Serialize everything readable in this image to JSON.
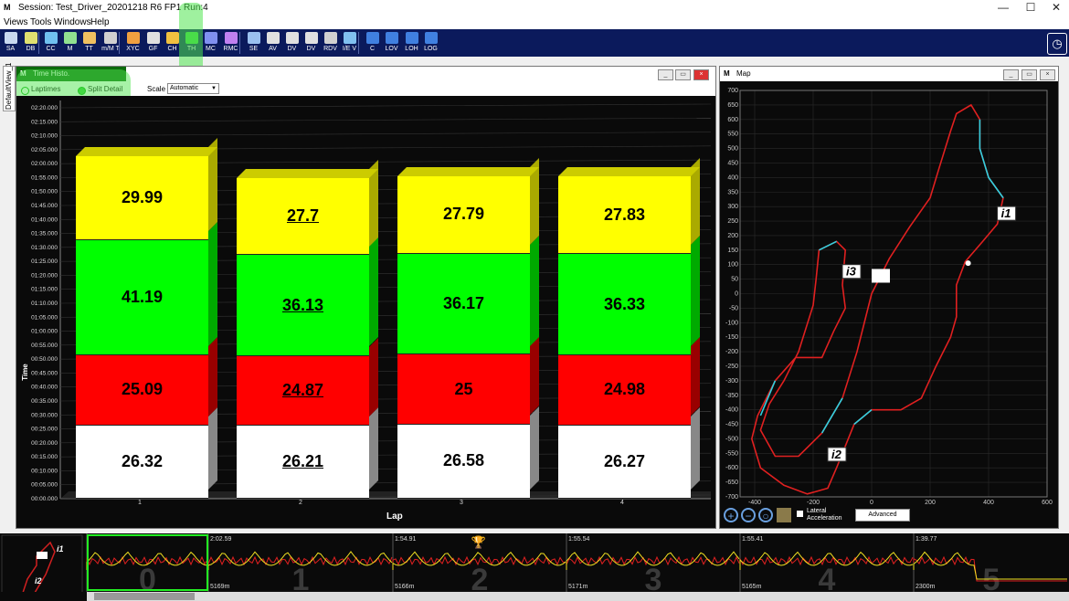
{
  "window": {
    "logo": "M",
    "title": "Session:  Test_Driver_20201218 R6 FP1 Run:4",
    "minimize": "—",
    "maximize": "☐",
    "close": "✕"
  },
  "menu": [
    "Views",
    "Tools",
    "Windows",
    "Help"
  ],
  "toolbar": {
    "buttons": [
      "SA",
      "DB",
      "CC",
      "M",
      "TT",
      "m/M T",
      "XYC",
      "GF",
      "CH",
      "TH",
      "MC",
      "RMC",
      "SE",
      "AV",
      "DV",
      "DV",
      "RDV",
      "I/E V",
      "C",
      "LOV",
      "LOH",
      "LOG"
    ],
    "icons": [
      "sa-icon",
      "db-icon",
      "cc-icon",
      "m-icon",
      "tt-icon",
      "mmt-icon",
      "xyc-icon",
      "gf-icon",
      "ch-icon",
      "th-icon",
      "mc-icon",
      "rmc-icon",
      "se-icon",
      "av-icon",
      "dv-icon",
      "dv2-icon",
      "rdv-icon",
      "iev-icon",
      "c-icon",
      "lov-icon",
      "loh-icon",
      "log-icon"
    ],
    "clock_icon": "clock-icon"
  },
  "sidetab": "DefaultView_1",
  "timehisto": {
    "title": "Time Histo.",
    "radio_laptimes": "Laptimes",
    "radio_split": "Split Detail",
    "scale_label": "Scale",
    "scale_value": "Automatic"
  },
  "map": {
    "title": "Map",
    "sector_labels": [
      "i1",
      "i2",
      "i3"
    ],
    "lateral_label_1": "Lateral",
    "lateral_label_2": "Acceleration",
    "advanced": "Advanced",
    "yticks": [
      "700",
      "650",
      "600",
      "550",
      "500",
      "450",
      "400",
      "350",
      "300",
      "250",
      "200",
      "150",
      "100",
      "50",
      "0",
      "-50",
      "-100",
      "-150",
      "-200",
      "-250",
      "-300",
      "-350",
      "-400",
      "-450",
      "-500",
      "-550",
      "-600",
      "-650",
      "-700"
    ],
    "xticks": [
      "-400",
      "-200",
      "0",
      "200",
      "400",
      "600"
    ]
  },
  "chart_data": {
    "type": "bar",
    "stacked": true,
    "xlabel": "Lap",
    "ylabel": "Time",
    "ylim": [
      0,
      140
    ],
    "categories": [
      "1",
      "2",
      "3",
      "4"
    ],
    "series": [
      {
        "color": "#ffffff",
        "values": [
          26.32,
          26.21,
          26.58,
          26.27
        ]
      },
      {
        "color": "#ff0000",
        "values": [
          25.09,
          24.87,
          25,
          24.98
        ]
      },
      {
        "color": "#00ff00",
        "values": [
          41.19,
          36.13,
          36.17,
          36.33
        ]
      },
      {
        "color": "#ffff00",
        "values": [
          29.99,
          27.7,
          27.79,
          27.83
        ]
      }
    ],
    "underlined_lap": "2",
    "y_tick_labels": [
      "00:00.000",
      "00:05.000",
      "00:10.000",
      "00:15.000",
      "00:20.000",
      "00:25.000",
      "00:30.000",
      "00:35.000",
      "00:40.000",
      "00:45.000",
      "00:50.000",
      "00:55.000",
      "01:00.000",
      "01:05.000",
      "01:10.000",
      "01:15.000",
      "01:20.000",
      "01:25.000",
      "01:30.000",
      "01:35.000",
      "01:40.000",
      "01:45.000",
      "01:50.000",
      "01:55.000",
      "02:00.000",
      "02:05.000",
      "02:10.000",
      "02:15.000",
      "02:20.000"
    ]
  },
  "strip": {
    "laps": [
      {
        "num": "0",
        "time": "",
        "dist": ""
      },
      {
        "num": "1",
        "time": "2:02.59",
        "dist": "5169m"
      },
      {
        "num": "2",
        "time": "1:54.91",
        "dist": "5166m"
      },
      {
        "num": "3",
        "time": "1:55.54",
        "dist": "5171m"
      },
      {
        "num": "4",
        "time": "1:55.41",
        "dist": "5165m"
      },
      {
        "num": "5",
        "time": "1:39.77",
        "dist": "2300m"
      }
    ],
    "mini_map_labels": [
      "i1",
      "i2"
    ],
    "trophy_icon": "trophy-icon"
  }
}
